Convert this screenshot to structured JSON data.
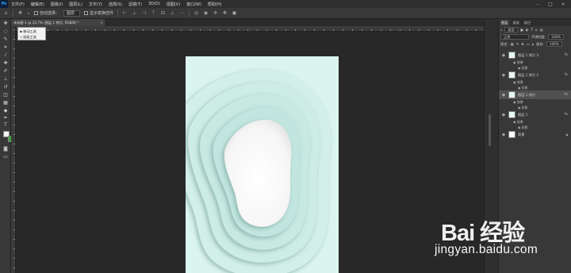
{
  "app": {
    "logo": "Ps"
  },
  "menu": [
    "文件(F)",
    "编辑(E)",
    "图像(I)",
    "图层(L)",
    "文字(Y)",
    "选择(S)",
    "滤镜(T)",
    "3D(D)",
    "视图(V)",
    "窗口(W)",
    "帮助(H)"
  ],
  "options": {
    "auto_select_label": "自动选择：",
    "auto_select_value": "图层",
    "show_transform_label": "显示变换控件"
  },
  "document": {
    "tab_title": "未标题-1 @ 33.7% (图层 1 拷贝, RGB/8) *",
    "tab_close": "×"
  },
  "tool_popup": {
    "items": [
      "移动工具",
      "画板工具"
    ]
  },
  "panel": {
    "tabs": [
      "图层",
      "通道",
      "路径"
    ],
    "filter_label": "类型",
    "blend_mode": "正常",
    "opacity_label": "不透明度:",
    "opacity_value": "100%",
    "lock_label": "锁定:",
    "fill_label": "填充:",
    "fill_value": "100%",
    "layers": [
      {
        "name": "图层 1 拷贝 3",
        "effects_label": "效果",
        "effect": "投影",
        "selected": false
      },
      {
        "name": "图层 1 拷贝 2",
        "effects_label": "效果",
        "effect": "投影",
        "selected": false
      },
      {
        "name": "图层 1 拷贝",
        "effects_label": "效果",
        "effect": "投影",
        "selected": true
      },
      {
        "name": "图层 1",
        "effects_label": "效果",
        "effect": "投影",
        "selected": false
      },
      {
        "name": "背景"
      }
    ]
  },
  "watermark": {
    "brand": "Bai 经验",
    "url": "jingyan.baidu.com"
  },
  "colors": {
    "canvas_bg": "#dbf4ef",
    "foreground": "#f0f6f8",
    "background": "#3aa63a",
    "accent": "#31a8ff"
  }
}
